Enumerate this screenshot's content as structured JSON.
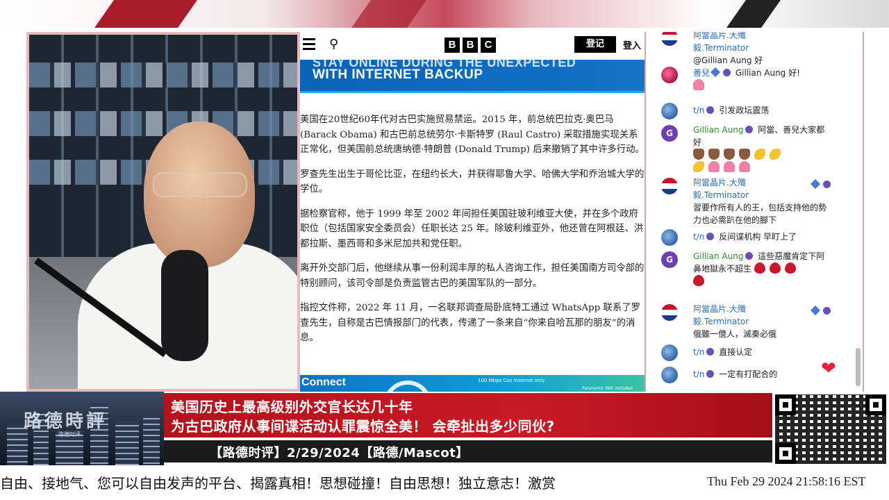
{
  "bbc": {
    "logo_letters": [
      "B",
      "B",
      "C"
    ],
    "register_label": "登记",
    "login_label": "登入",
    "ad_top_line1": "STAY ONLINE DURING THE UNEXPECTED",
    "ad_top_line2": "WITH INTERNET BACKUP",
    "ad_bottom_connect": "Connect",
    "ad_bottom_speed": "100 Mbps Cox Internet only",
    "ad_bottom_wifi": "Panoramic WiFi included"
  },
  "article": {
    "paragraphs": [
      "美国在20世纪60年代对古巴实施贸易禁运。2015 年，前总统巴拉克·奥巴马 (Barack Obama) 和古巴前总统劳尔·卡斯特罗 (Raul Castro) 采取措施实现关系正常化，但美国前总统唐纳德·特朗普 (Donald Trump) 后来撤销了其中许多行动。",
      "罗查先生出生于哥伦比亚，在纽约长大，并获得耶鲁大学、哈佛大学和乔治城大学的学位。",
      "据检察官称，他于 1999 年至 2002 年间担任美国驻玻利维亚大使，并在多个政府职位（包括国家安全委员会）任职长达 25 年。除玻利维亚外，他还曾在阿根廷、洪都拉斯、墨西哥和多米尼加共和党任职。",
      "离开外交部门后，他继续从事一份利润丰厚的私人咨询工作，担任美国南方司令部的特别顾问，该司令部是负责监管古巴的美国军队的一部分。",
      "指控文件称，2022 年 11 月，一名联邦调查局卧底特工通过 WhatsApp 联系了罗查先生，自称是古巴情报部门的代表，传递了一条来自“你来自哈瓦那的朋友”的消息。"
    ]
  },
  "chat": {
    "messages": [
      {
        "author": "阿當晶片.大殲毅.Terminator",
        "text": "@Gillian Aung 好"
      },
      {
        "author": "善兒",
        "text": "Gillian Aung 好!"
      },
      {
        "author": "t/n",
        "text": "引发政坛震荡"
      },
      {
        "author": "Gillian Aung",
        "text": "阿當、善兒大家都好"
      },
      {
        "author": "阿當晶片.大殲毅.Terminator",
        "text": "習要作所有人的王，包括支持他的勢力也必需趴在他的腳下"
      },
      {
        "author": "t/n",
        "text": "反间谍机构 早盯上了"
      },
      {
        "author": "Gillian Aung",
        "text": "這些惡魔肯定下阿鼻地獄永不超生"
      },
      {
        "author": "阿當晶片.大殲毅.Terminator",
        "text": "俄雖一億人，滅秦必俄"
      },
      {
        "author": "t/n",
        "text": "直接认定"
      },
      {
        "author": "t/n",
        "text": "一定有打配合的"
      }
    ]
  },
  "lower_third": {
    "brand": "路德時評",
    "brand_sub": "路德时评",
    "headline_line1": "美国历史上最高级别外交官长达几十年",
    "headline_line2": "为古巴政府从事间谍活动认罪震惊全美！ 会牵扯出多少同伙?",
    "program": "【路德时评】2/29/2024【路德/Mascot】"
  },
  "ticker": {
    "text": "自由、接地气、您可以自由发声的平台、揭露真相！思想碰撞！自由思想！独立意志！激赏",
    "clock": "Thu Feb 29 2024 21:58:16 EST"
  },
  "colors": {
    "headline_red": "#c81a24",
    "panel_border": "#e9b7bd",
    "chat_author": "#2a6bb8",
    "gillian_green": "#2e8b2e"
  }
}
